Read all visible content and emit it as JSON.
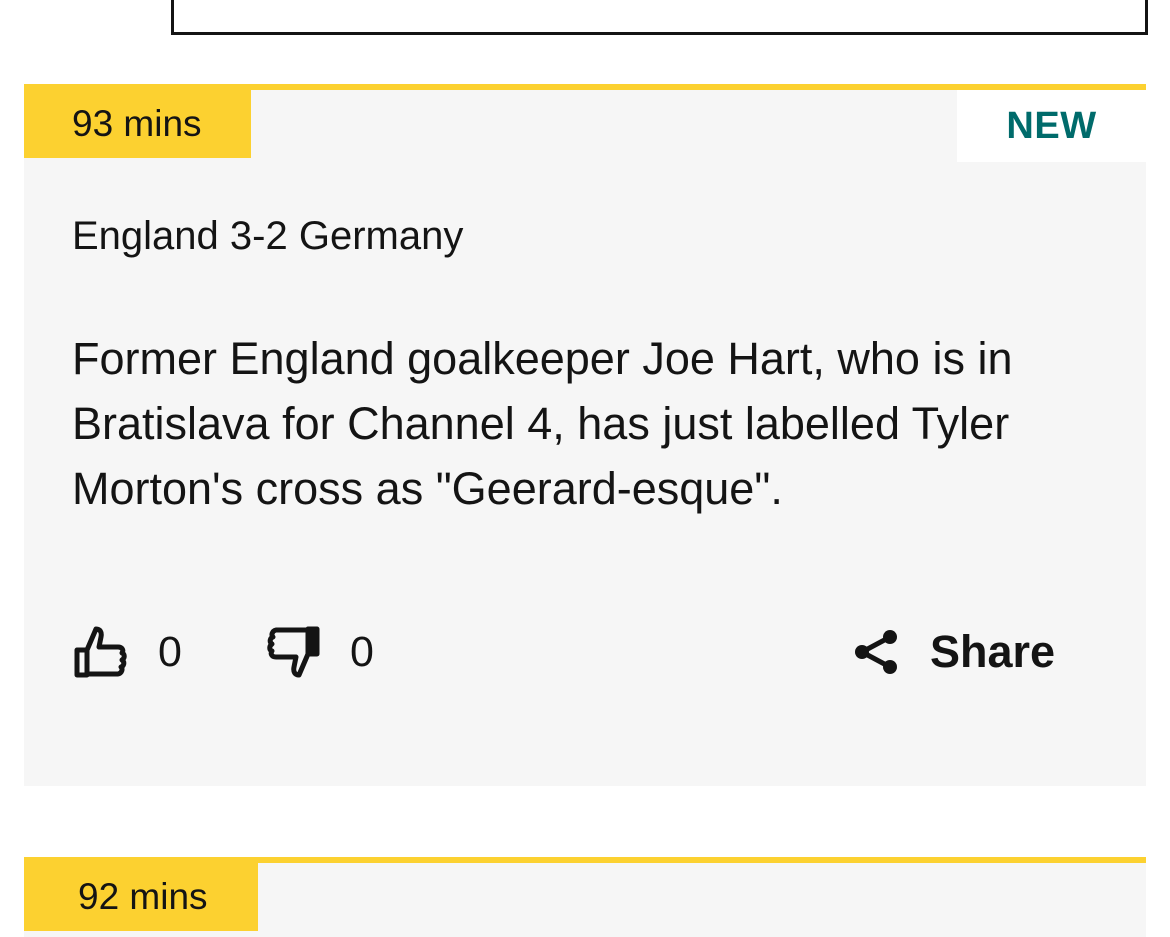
{
  "entries": [
    {
      "time": "93 mins",
      "badge": "NEW",
      "subtitle": "England 3-2 Germany",
      "body": "Former England goalkeeper Joe Hart, who is in Bratislava for Channel 4, has just labelled Tyler Morton's cross as \"Geerard-esque\".",
      "likes": "0",
      "dislikes": "0",
      "share_label": "Share",
      "icons": {
        "like": "thumbs-up-icon",
        "dislike": "thumbs-down-icon",
        "share": "share-icon"
      }
    },
    {
      "time": "92 mins"
    }
  ],
  "colors": {
    "accent": "#fcd130",
    "card_bg": "#f6f6f6",
    "new_badge_text": "#006b6b",
    "text": "#141414"
  }
}
